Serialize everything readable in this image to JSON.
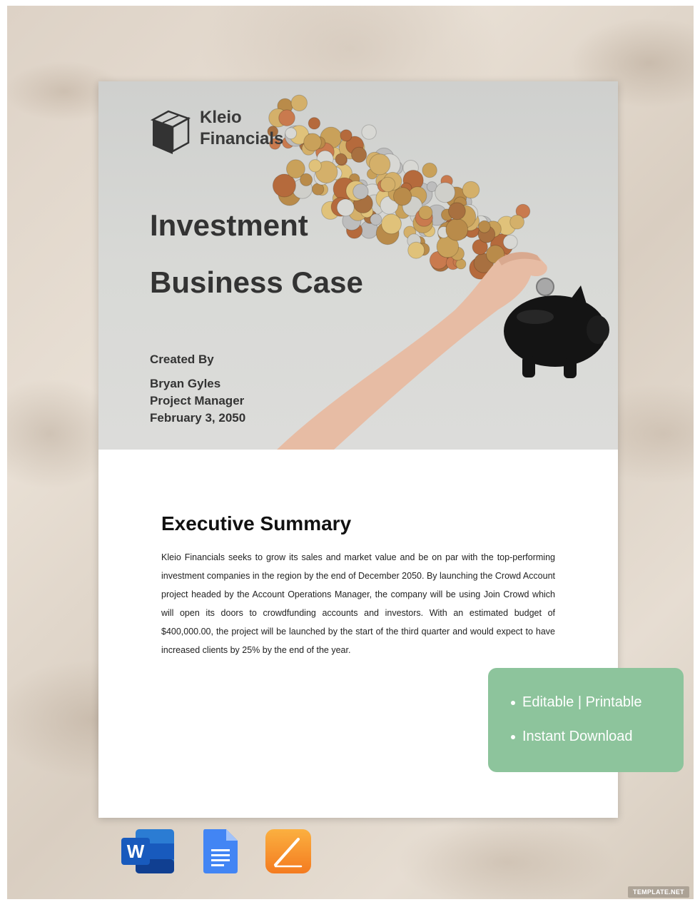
{
  "cover": {
    "logo_line1": "Kleio",
    "logo_line2": "Financials",
    "title_line1": "Investment",
    "title_line2": "Business Case",
    "created_by_label": "Created By",
    "author": "Bryan Gyles",
    "role": "Project Manager",
    "date": "February 3, 2050"
  },
  "summary": {
    "heading": "Executive Summary",
    "body": "Kleio Financials seeks to grow its sales and market value and be on par with the top-performing investment companies in the region by the end of December 2050. By launching the Crowd Account project headed by the Account Operations Manager, the company will be using Join Crowd which will open its doors to crowdfunding accounts and investors. With an estimated budget of $400,000.00, the project will be launched by the start of the third quarter and would expect to have increased clients by 25% by the end of the year."
  },
  "badge": {
    "item1": "Editable | Printable",
    "item2": "Instant Download",
    "color": "#8dc49c"
  },
  "apps": [
    {
      "icon": "microsoft-word-icon",
      "letter": "W",
      "color": "#185abd"
    },
    {
      "icon": "google-docs-icon",
      "color": "#4285f4"
    },
    {
      "icon": "apple-pages-icon",
      "color": "#f7941d"
    }
  ],
  "watermark": "TEMPLATE.NET"
}
